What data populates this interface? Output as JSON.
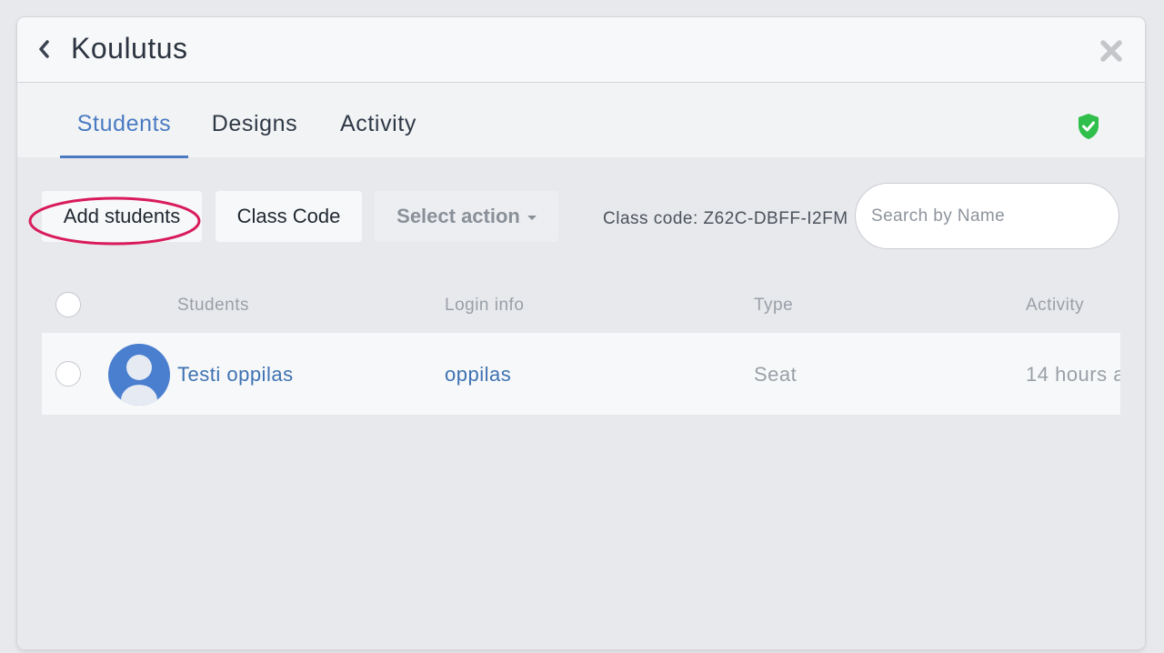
{
  "header": {
    "title": "Koulutus",
    "back_icon": "chevron-left-icon",
    "close_icon": "close-icon"
  },
  "tabs": [
    {
      "label": "Students",
      "active": true
    },
    {
      "label": "Designs",
      "active": false
    },
    {
      "label": "Activity",
      "active": false
    }
  ],
  "status_icon": "shield-check-icon",
  "toolbar": {
    "add_students_label": "Add students",
    "class_code_label": "Class Code",
    "select_action_label": "Select action",
    "class_code_text": "Class code: Z62C-DBFF-I2FM",
    "search_placeholder": "Search by Name",
    "search_value": ""
  },
  "table": {
    "columns": [
      "Students",
      "Login info",
      "Type",
      "Activity"
    ],
    "rows": [
      {
        "name": "Testi oppilas",
        "login": "oppilas",
        "type": "Seat",
        "activity": "14 hours a",
        "avatar": "user-avatar-icon"
      }
    ]
  },
  "colors": {
    "accent": "#4a7bc2",
    "link": "#3e72b3",
    "highlight": "#d81b5a",
    "shield": "#2fbf4a"
  }
}
